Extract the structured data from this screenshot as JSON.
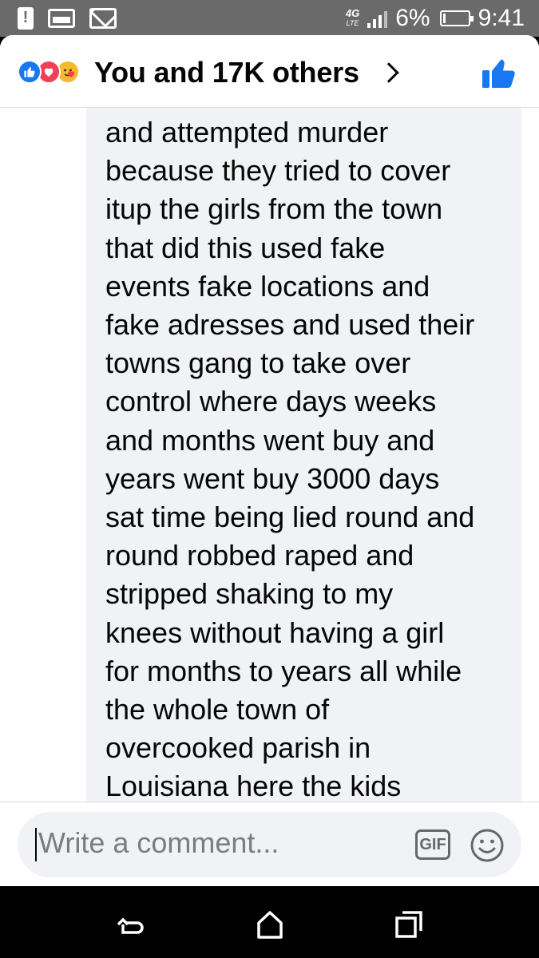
{
  "status_bar": {
    "network": "4G",
    "network_sub": "LTE",
    "battery": "6%",
    "time": "9:41"
  },
  "reactions": {
    "summary": "You and 17K others",
    "icons": [
      "like-icon",
      "love-icon",
      "care-icon"
    ]
  },
  "comment": {
    "lines": [
      "and attempted murder",
      "because they tried to cover",
      "itup the girls from the town",
      "that did this used fake",
      "events fake locations and",
      "fake adresses and used their",
      "towns gang to take over",
      "control where days weeks",
      "and months went buy and",
      "years went buy 3000 days",
      "sat time being lied round and",
      "round robbed raped and",
      "stripped shaking to my",
      "knees without having a girl",
      "for months to years all while",
      "the whole town of",
      "overcooked parish in",
      "Louisiana here the kids"
    ]
  },
  "composer": {
    "placeholder": "Write a comment...",
    "gif_label": "GIF"
  },
  "colors": {
    "accent": "#1877f2",
    "love": "#f33e58",
    "bubble": "#f0f2f5",
    "status_bar": "#6a6a6a"
  }
}
